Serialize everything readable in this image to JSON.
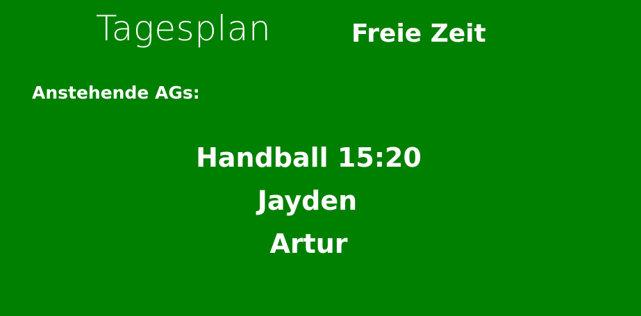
{
  "window": {
    "background_color": "#008000",
    "text_color": "#ffffff"
  },
  "header": {
    "title": "Tagesplan",
    "mode": "Freie Zeit"
  },
  "upcoming": {
    "label": "Anstehende AGs:",
    "items": [
      "Handball 15:20",
      "Jayden",
      "Artur"
    ]
  }
}
